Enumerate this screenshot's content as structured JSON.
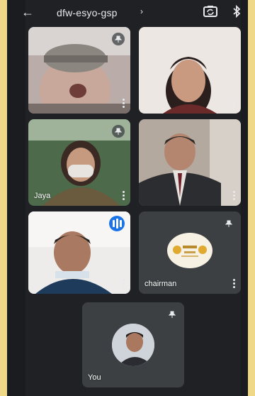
{
  "header": {
    "meeting_code": "dfw-esyo-gsp",
    "chevron": "›"
  },
  "participants": [
    {
      "name": "",
      "tile": "participant-1"
    },
    {
      "name": "",
      "tile": "participant-2"
    },
    {
      "name": "Jaya",
      "tile": "participant-3"
    },
    {
      "name": "",
      "tile": "participant-4"
    },
    {
      "name": "",
      "tile": "participant-5"
    },
    {
      "name": "chairman",
      "tile": "participant-6"
    },
    {
      "name": "You",
      "tile": "self"
    }
  ],
  "colors": {
    "background": "#202124",
    "tile_dark": "#3c4043",
    "speaking_highlight": "#8ab4f8",
    "speaking_badge": "#1a73e8",
    "frame": "#f0d889"
  },
  "icons": [
    "back-arrow-icon",
    "chevron-right-icon",
    "switch-camera-icon",
    "bluetooth-icon",
    "pin-icon",
    "more-vert-icon",
    "speaking-indicator-icon"
  ]
}
